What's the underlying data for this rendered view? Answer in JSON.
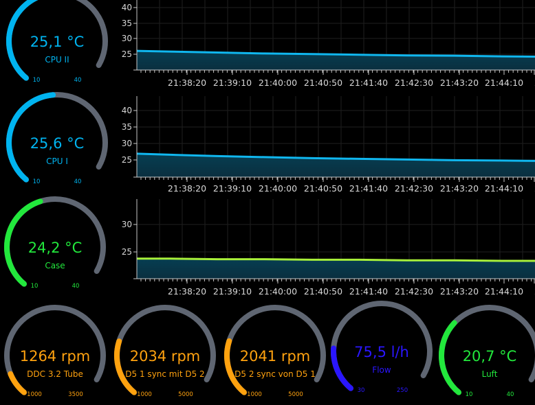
{
  "colors": {
    "track": "#5f6672",
    "blue": "#00b4f0",
    "green": "#22e83c",
    "orange": "#ffa20f",
    "deepblue": "#2a16ff",
    "axis": "#c9c9c9",
    "area": "#063e52",
    "line_blue": "#10b7ef",
    "line_lime": "#a8f03a"
  },
  "charts_x_ticks": [
    "21:38:20",
    "21:39:10",
    "21:40:00",
    "21:40:50",
    "21:41:40",
    "21:42:30",
    "21:43:20",
    "21:44:10",
    "2"
  ],
  "gauges": [
    {
      "id": "cpu2",
      "value": "25,1 °C",
      "label": "CPU II",
      "min": "10",
      "max": "40",
      "fill": 0.5,
      "color": "blue"
    },
    {
      "id": "cpu1",
      "value": "25,6 °C",
      "label": "CPU I",
      "min": "10",
      "max": "40",
      "fill": 0.52,
      "color": "blue"
    },
    {
      "id": "case",
      "value": "24,2 °C",
      "label": "Case",
      "min": "10",
      "max": "40",
      "fill": 0.47,
      "color": "green"
    },
    {
      "id": "ddc",
      "value": "1264 rpm",
      "label": "DDC 3.2 Tube",
      "min": "1000",
      "max": "3500",
      "fill": 0.106,
      "color": "orange"
    },
    {
      "id": "d51",
      "value": "2034 rpm",
      "label": "D5 1 sync mit D5 2",
      "min": "1000",
      "max": "5000",
      "fill": 0.259,
      "color": "orange"
    },
    {
      "id": "d52",
      "value": "2041 rpm",
      "label": "D5 2 sync von D5 1",
      "min": "1000",
      "max": "5000",
      "fill": 0.26,
      "color": "orange"
    },
    {
      "id": "flow",
      "value": "75,5 l/h",
      "label": "Flow",
      "min": "30",
      "max": "250",
      "fill": 0.207,
      "color": "deepblue"
    },
    {
      "id": "luft",
      "value": "20,7 °C",
      "label": "Luft",
      "min": "10",
      "max": "40",
      "fill": 0.357,
      "color": "green"
    }
  ],
  "chart_data": [
    {
      "type": "line",
      "y_ticks": [
        "40",
        "35",
        "30",
        "25"
      ],
      "ylim": [
        21,
        43
      ],
      "x": [
        "21:37:45",
        "21:38:20",
        "21:39:10",
        "21:40:00",
        "21:40:50",
        "21:41:40",
        "21:42:30",
        "21:43:20",
        "21:44:10",
        "21:44:45"
      ],
      "series": [
        {
          "values": [
            27.0,
            26.8,
            26.5,
            26.2,
            26.0,
            25.8,
            25.6,
            25.5,
            25.3,
            25.2
          ]
        }
      ]
    },
    {
      "type": "line",
      "y_ticks": [
        "40",
        "35",
        "30",
        "25"
      ],
      "ylim": [
        21,
        44.5
      ],
      "x": [
        "21:37:45",
        "21:38:20",
        "21:39:10",
        "21:40:00",
        "21:40:50",
        "21:41:40",
        "21:42:30",
        "21:43:20",
        "21:44:10",
        "21:44:45"
      ],
      "series": [
        {
          "values": [
            27.8,
            27.5,
            27.1,
            26.8,
            26.5,
            26.3,
            26.1,
            25.9,
            25.8,
            25.7
          ]
        }
      ]
    },
    {
      "type": "line",
      "y_ticks": [
        "30",
        "25"
      ],
      "ylim": [
        21,
        35.3
      ],
      "x": [
        "21:37:45",
        "21:38:20",
        "21:39:10",
        "21:40:00",
        "21:40:50",
        "21:41:40",
        "21:42:30",
        "21:43:20",
        "21:44:10",
        "21:44:45"
      ],
      "series": [
        {
          "values": [
            24.6,
            24.6,
            24.5,
            24.5,
            24.4,
            24.4,
            24.3,
            24.3,
            24.2,
            24.2
          ]
        }
      ]
    }
  ]
}
